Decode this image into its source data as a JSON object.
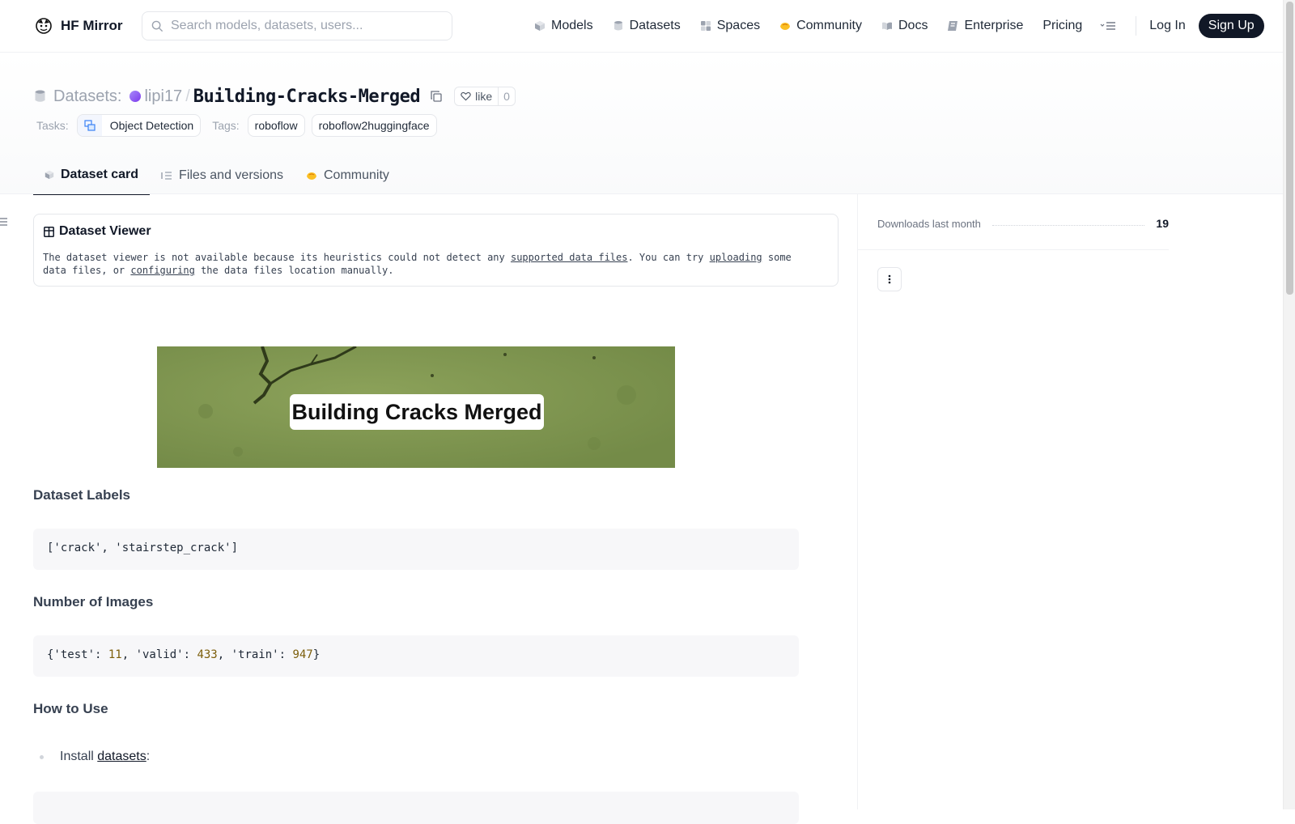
{
  "nav": {
    "brand": "HF Mirror",
    "search_placeholder": "Search models, datasets, users...",
    "links": [
      "Models",
      "Datasets",
      "Spaces",
      "Community",
      "Docs",
      "Enterprise",
      "Pricing"
    ],
    "login": "Log In",
    "signup": "Sign Up"
  },
  "header": {
    "section": "Datasets:",
    "owner": "lipi17",
    "repo": "Building-Cracks-Merged",
    "like_label": "like",
    "like_count": "0",
    "tasks_label": "Tasks:",
    "task": "Object Detection",
    "tags_label": "Tags:",
    "tags": [
      "roboflow",
      "roboflow2huggingface"
    ]
  },
  "tabs": [
    "Dataset card",
    "Files and versions",
    "Community"
  ],
  "viewer": {
    "title": "Dataset Viewer",
    "text_1": "The dataset viewer is not available because its heuristics could not detect any ",
    "link_supported": "supported data files",
    "text_2": ". You can try ",
    "link_uploading": "uploading",
    "text_3": " some data files, or ",
    "link_configuring": "configuring",
    "text_4": " the data files location manually."
  },
  "banner_title": "Building Cracks Merged",
  "card": {
    "labels_heading": "Dataset Labels",
    "labels_code": "['crack', 'stairstep_crack']",
    "images_heading": "Number of Images",
    "images_code": {
      "prefix": "{'test': ",
      "test": "11",
      "sep1": ", 'valid': ",
      "valid": "433",
      "sep2": ", 'train': ",
      "train": "947",
      "suffix": "}"
    },
    "howto_heading": "How to Use",
    "install_text": "Install ",
    "install_link": "datasets",
    "install_colon": ":"
  },
  "sidebar": {
    "downloads_label": "Downloads last month",
    "downloads_value": "19"
  },
  "colors": {
    "accent_dark": "#111827",
    "muted": "#9ca3af",
    "banner_green": "#7d9450"
  }
}
